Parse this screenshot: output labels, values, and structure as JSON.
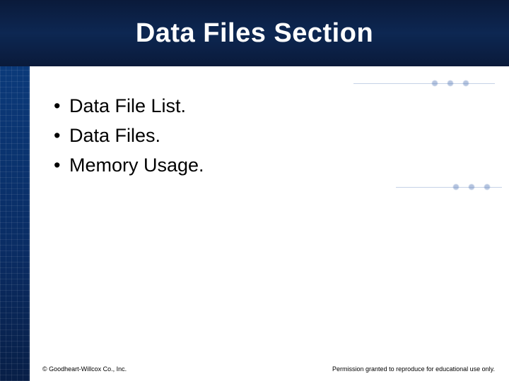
{
  "header": {
    "title": "Data Files Section"
  },
  "content": {
    "bullets": [
      "Data File List.",
      "Data Files.",
      "Memory Usage."
    ]
  },
  "footer": {
    "copyright": "© Goodheart-Willcox Co., Inc.",
    "permission": "Permission granted to reproduce for educational use only."
  }
}
